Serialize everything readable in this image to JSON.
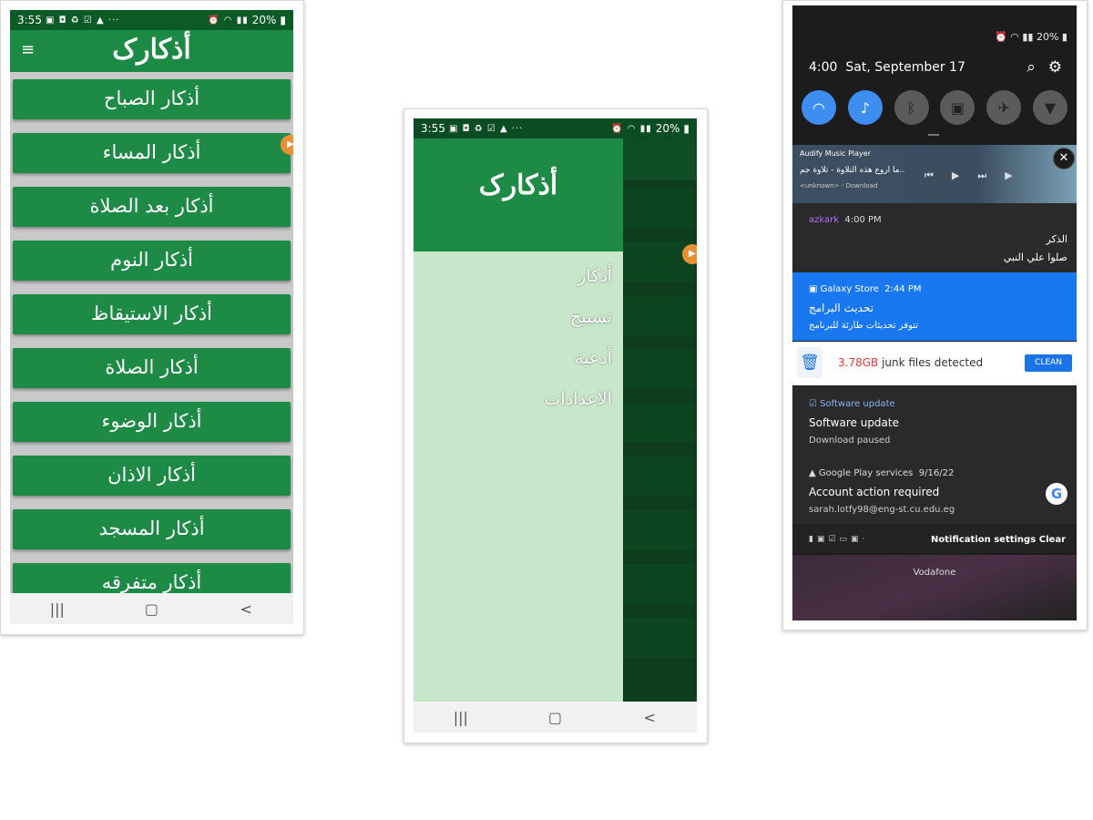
{
  "phone1": {
    "status": {
      "time": "3:55",
      "battery": "20%"
    },
    "app_title": "أذكارک",
    "items": [
      "أذكار الصباح",
      "أذكار المساء",
      "أذكار بعد الصلاة",
      "أذكار النوم",
      "أذكار الاستيقاظ",
      "أذكار الصلاة",
      "أذكار الوضوء",
      "أذكار الاذان",
      "أذكار المسجد",
      "أذكار متفرقه"
    ]
  },
  "phone2": {
    "status": {
      "time": "3:55",
      "battery": "20%"
    },
    "drawer_title": "أذكارک",
    "menu": [
      "أذكار",
      "تسبيح",
      "أدعية",
      "الاعدادات"
    ]
  },
  "phone3": {
    "status": {
      "battery": "20%"
    },
    "time": "4:00",
    "date": "Sat, September 17",
    "media": {
      "app": "Audify Music Player",
      "title": "ما اروع هذه التلاوة - تلاوة جم..",
      "subtitle": "<unknown> - Download"
    },
    "azkark": {
      "app": "azkark",
      "time": "4:00 PM",
      "title": "الذكر",
      "text": "صلوا علي النبي"
    },
    "galaxy": {
      "app": "Galaxy Store",
      "time": "2:44 PM",
      "title": "تحديث البرامج",
      "text": "تتوفر تحديثات طارئة للبرنامج"
    },
    "junk": {
      "size": "3.78GB",
      "text": " junk files detected",
      "button": "CLEAN"
    },
    "software": {
      "app": "Software update",
      "title": "Software update",
      "text": "Download paused"
    },
    "gplay": {
      "app": "Google Play services",
      "date": "9/16/22",
      "title": "Account action required",
      "text": "sarah.lotfy98@eng-st.cu.edu.eg"
    },
    "footer": {
      "settings": "Notification settings",
      "clear": "Clear"
    },
    "carrier": "Vodafone"
  }
}
